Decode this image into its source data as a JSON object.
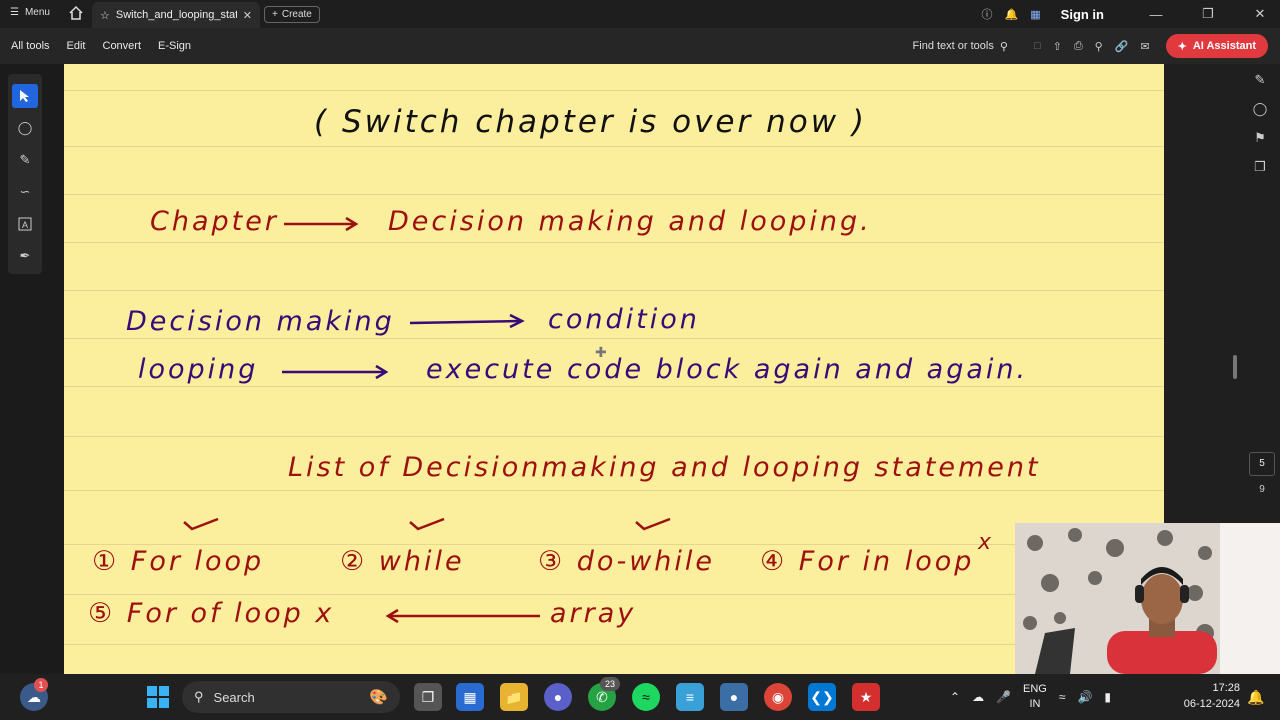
{
  "titlebar": {
    "menu_label": "Menu",
    "tab_title": "Switch_and_looping_stat...",
    "create_label": "Create",
    "signin_label": "Sign in"
  },
  "toolbar": {
    "items": [
      "All tools",
      "Edit",
      "Convert",
      "E-Sign"
    ],
    "find_label": "Find text or tools",
    "ai_label": "AI Assistant"
  },
  "page": {
    "title": "( Switch chapter is over now )",
    "chapter": "Chapter",
    "chapter_topic": "Decision making and looping.",
    "decision_label": "Decision making",
    "decision_result": "condition",
    "looping_label": "looping",
    "looping_result": "execute code block again and again.",
    "list_heading": "List of Decisionmaking and looping statement",
    "loops": [
      "① For loop",
      "② while",
      "③ do-while",
      "④ For in loop",
      "⑤ For of loop x"
    ],
    "array_label": "array",
    "cross_mark": "x"
  },
  "navigator": {
    "page_number": "5",
    "page_total": "9"
  },
  "taskbar": {
    "search_placeholder": "Search",
    "notification_badge": "1",
    "whatsapp_badge": "23",
    "lang_top": "ENG",
    "lang_bottom": "IN",
    "time": "17:28",
    "date": "06-12-2024"
  },
  "colors": {
    "page_bg": "#fbee9c",
    "ink_red": "#9e1010",
    "ink_purple": "#3a0a78",
    "accent": "#e03a3e"
  }
}
